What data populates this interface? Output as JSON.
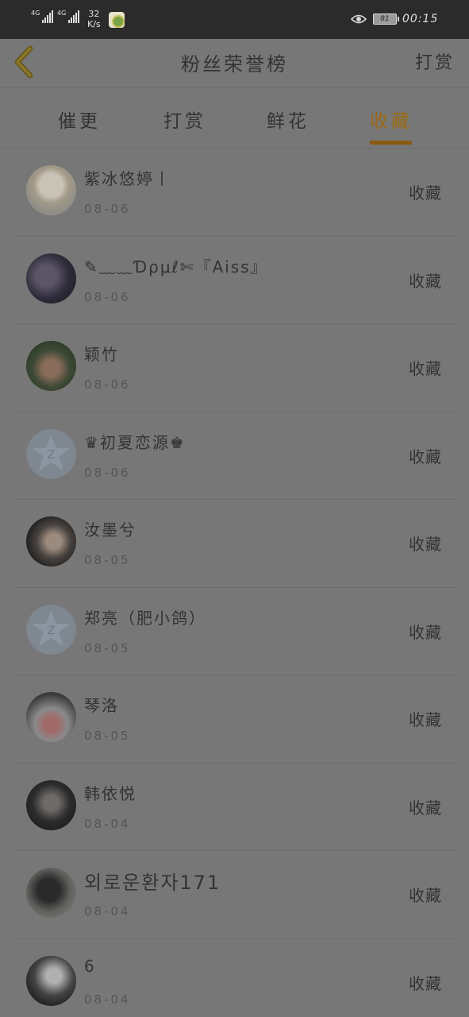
{
  "status_bar": {
    "network_1": "4G",
    "network_2": "4G",
    "speed_value": "32",
    "speed_unit": "K/s",
    "battery": "81",
    "time": "00:15"
  },
  "nav": {
    "title": "粉丝荣誉榜",
    "reward_label": "打赏"
  },
  "tabs": [
    {
      "label": "催更"
    },
    {
      "label": "打赏"
    },
    {
      "label": "鲜花"
    },
    {
      "label": "收藏"
    }
  ],
  "active_tab": "收藏",
  "colors": {
    "accent": "#9a6a13",
    "overlay_bg": "#777777",
    "status_bar_bg": "#2b2b2b"
  },
  "fans": [
    {
      "name": "紫冰悠婷丨",
      "date": "08-06",
      "action": "收藏",
      "avatar": "photo-avatar"
    },
    {
      "name": "✎﹏﹏Ɗρμℓ✄『Aiss』",
      "date": "08-06",
      "action": "收藏",
      "avatar": "photo-avatar"
    },
    {
      "name": "颖竹",
      "date": "08-06",
      "action": "收藏",
      "avatar": "photo-avatar"
    },
    {
      "name": "♛初夏恋源♚",
      "date": "08-06",
      "action": "收藏",
      "avatar": "default-star-avatar"
    },
    {
      "name": "汝墨兮",
      "date": "08-05",
      "action": "收藏",
      "avatar": "photo-avatar"
    },
    {
      "name": "郑亮（肥小鸽）",
      "date": "08-05",
      "action": "收藏",
      "avatar": "default-star-avatar"
    },
    {
      "name": "琴洛",
      "date": "08-05",
      "action": "收藏",
      "avatar": "photo-avatar"
    },
    {
      "name": "韩依悦",
      "date": "08-04",
      "action": "收藏",
      "avatar": "photo-avatar"
    },
    {
      "name": "외로운환자171",
      "date": "08-04",
      "action": "收藏",
      "avatar": "photo-avatar"
    },
    {
      "name": "6",
      "date": "08-04",
      "action": "收藏",
      "avatar": "photo-avatar"
    }
  ]
}
